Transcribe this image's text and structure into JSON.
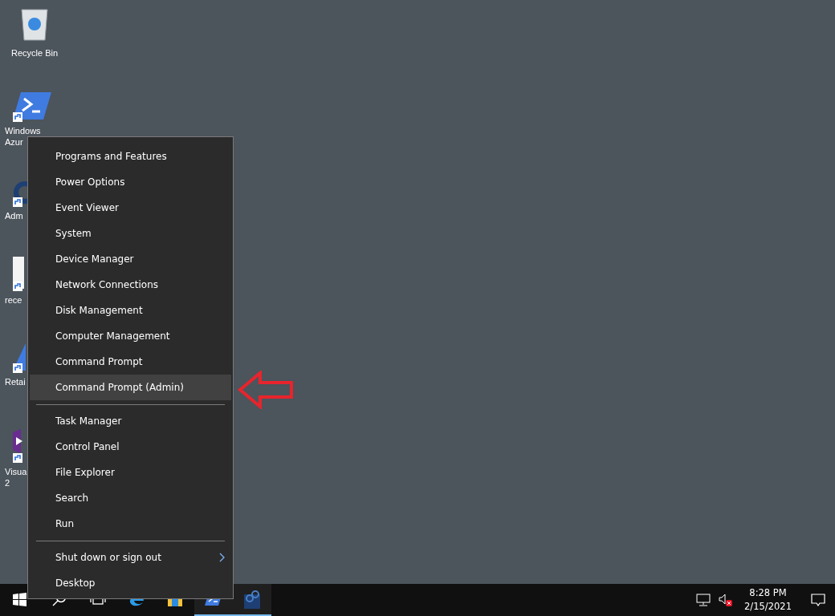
{
  "desktop_icons": [
    {
      "kind": "recycle-bin",
      "shortcut": false,
      "label_lines": [
        "Recycle Bin"
      ]
    },
    {
      "kind": "powershell",
      "shortcut": true,
      "label_lines": [
        "Windows",
        "Azur"
      ]
    },
    {
      "kind": "ring",
      "shortcut": true,
      "label_lines": [
        "Adm"
      ]
    },
    {
      "kind": "document",
      "shortcut": true,
      "label_lines": [
        "rece"
      ]
    },
    {
      "kind": "triangle",
      "shortcut": true,
      "label_lines": [
        "Retai"
      ]
    },
    {
      "kind": "studio",
      "shortcut": true,
      "label_lines": [
        "Visua",
        "2"
      ]
    }
  ],
  "context_menu": {
    "groups": [
      [
        {
          "label": "Programs and Features",
          "selected": false,
          "submenu": false
        },
        {
          "label": "Power Options",
          "selected": false,
          "submenu": false
        },
        {
          "label": "Event Viewer",
          "selected": false,
          "submenu": false
        },
        {
          "label": "System",
          "selected": false,
          "submenu": false
        },
        {
          "label": "Device Manager",
          "selected": false,
          "submenu": false
        },
        {
          "label": "Network Connections",
          "selected": false,
          "submenu": false
        },
        {
          "label": "Disk Management",
          "selected": false,
          "submenu": false
        },
        {
          "label": "Computer Management",
          "selected": false,
          "submenu": false
        },
        {
          "label": "Command Prompt",
          "selected": false,
          "submenu": false
        },
        {
          "label": "Command Prompt (Admin)",
          "selected": true,
          "submenu": false
        }
      ],
      [
        {
          "label": "Task Manager",
          "selected": false,
          "submenu": false
        },
        {
          "label": "Control Panel",
          "selected": false,
          "submenu": false
        },
        {
          "label": "File Explorer",
          "selected": false,
          "submenu": false
        },
        {
          "label": "Search",
          "selected": false,
          "submenu": false
        },
        {
          "label": "Run",
          "selected": false,
          "submenu": false
        }
      ],
      [
        {
          "label": "Shut down or sign out",
          "selected": false,
          "submenu": true
        },
        {
          "label": "Desktop",
          "selected": false,
          "submenu": false
        }
      ]
    ]
  },
  "taskbar": {
    "apps": [
      {
        "kind": "search",
        "open": false
      },
      {
        "kind": "task-view",
        "open": false
      },
      {
        "kind": "browser",
        "open": false
      },
      {
        "kind": "store",
        "open": false
      },
      {
        "kind": "powershell",
        "open": true
      },
      {
        "kind": "server",
        "open": true
      }
    ],
    "tray": {
      "volume_muted": true,
      "time": "8:28 PM",
      "date": "2/15/2021"
    }
  }
}
